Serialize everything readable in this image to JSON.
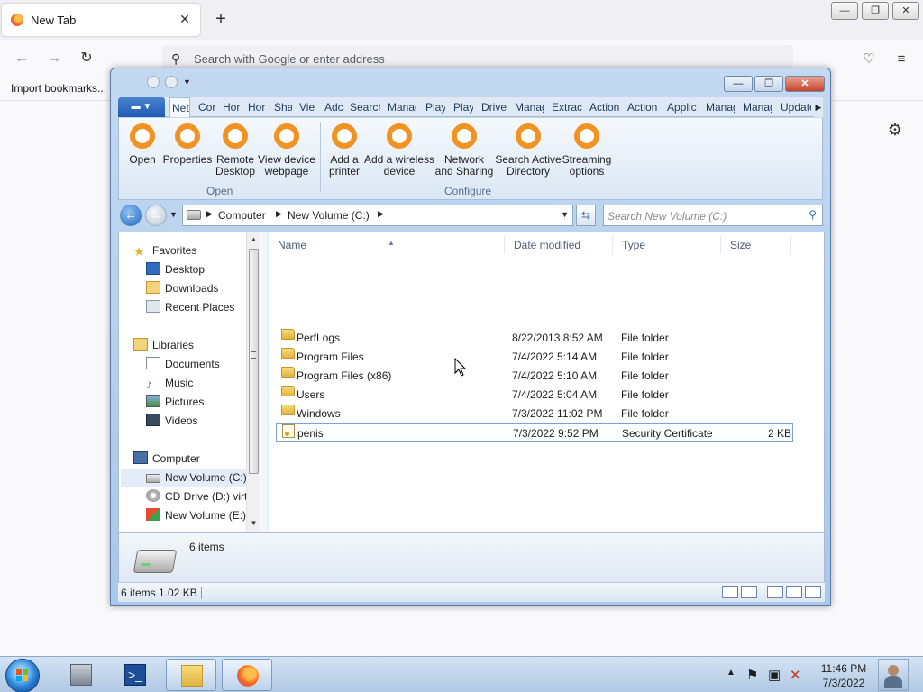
{
  "browser": {
    "tab_title": "New Tab",
    "tab_close": "✕",
    "new_tab": "+",
    "address_placeholder": "Search with Google or enter address",
    "bookmark": "Import bookmarks..."
  },
  "window_controls": {
    "minimize": "—",
    "restore": "❐",
    "close": "✕"
  },
  "explorer": {
    "ribbon_tabs": [
      "Net",
      "Cor",
      "Hor",
      "Hor",
      "Sha",
      "Vie",
      "Adc",
      "Search",
      "Manage",
      "Play",
      "Play",
      "Drive",
      "Manage",
      "Extract",
      "Action",
      "Action",
      "Applic",
      "Manage",
      "Manage",
      "Update"
    ],
    "ribbon": {
      "open_group": {
        "label": "Open",
        "buttons": [
          {
            "line1": "Open",
            "line2": ""
          },
          {
            "line1": "Properties",
            "line2": ""
          },
          {
            "line1": "Remote",
            "line2": "Desktop"
          },
          {
            "line1": "View device",
            "line2": "webpage"
          }
        ]
      },
      "configure_group": {
        "label": "Configure",
        "buttons": [
          {
            "line1": "Add a",
            "line2": "printer"
          },
          {
            "line1": "Add a wireless",
            "line2": "device"
          },
          {
            "line1": "Network",
            "line2": "and Sharing"
          },
          {
            "line1": "Search Active",
            "line2": "Directory"
          },
          {
            "line1": "Streaming",
            "line2": "options"
          }
        ]
      }
    },
    "breadcrumb": [
      "Computer",
      "New Volume (C:)"
    ],
    "search_placeholder": "Search New Volume (C:)",
    "nav": {
      "favorites_label": "Favorites",
      "favorites": [
        "Desktop",
        "Downloads",
        "Recent Places"
      ],
      "libraries_label": "Libraries",
      "libraries": [
        "Documents",
        "Music",
        "Pictures",
        "Videos"
      ],
      "computer_label": "Computer",
      "drives": [
        "New Volume (C:)",
        "CD Drive (D:) virtio",
        "New Volume (E:)"
      ]
    },
    "columns": {
      "name": "Name",
      "date": "Date modified",
      "type": "Type",
      "size": "Size"
    },
    "files": [
      {
        "name": "PerfLogs",
        "date": "8/22/2013 8:52 AM",
        "type": "File folder",
        "size": ""
      },
      {
        "name": "Program Files",
        "date": "7/4/2022 5:14 AM",
        "type": "File folder",
        "size": ""
      },
      {
        "name": "Program Files (x86)",
        "date": "7/4/2022 5:10 AM",
        "type": "File folder",
        "size": ""
      },
      {
        "name": "Users",
        "date": "7/4/2022 5:04 AM",
        "type": "File folder",
        "size": ""
      },
      {
        "name": "Windows",
        "date": "7/3/2022 11:02 PM",
        "type": "File folder",
        "size": ""
      },
      {
        "name": "penis",
        "date": "7/3/2022 9:52 PM",
        "type": "Security Certificate",
        "size": "2 KB"
      }
    ],
    "details_count": "6 items",
    "status": {
      "items": "6 items",
      "size": "1.02 KB"
    }
  },
  "taskbar": {
    "time": "11:46 PM",
    "date": "7/3/2022"
  },
  "colors": {
    "ribbon_icon": "#f29222",
    "selection": "#e3ecf8",
    "accent": "#1f64b8"
  }
}
